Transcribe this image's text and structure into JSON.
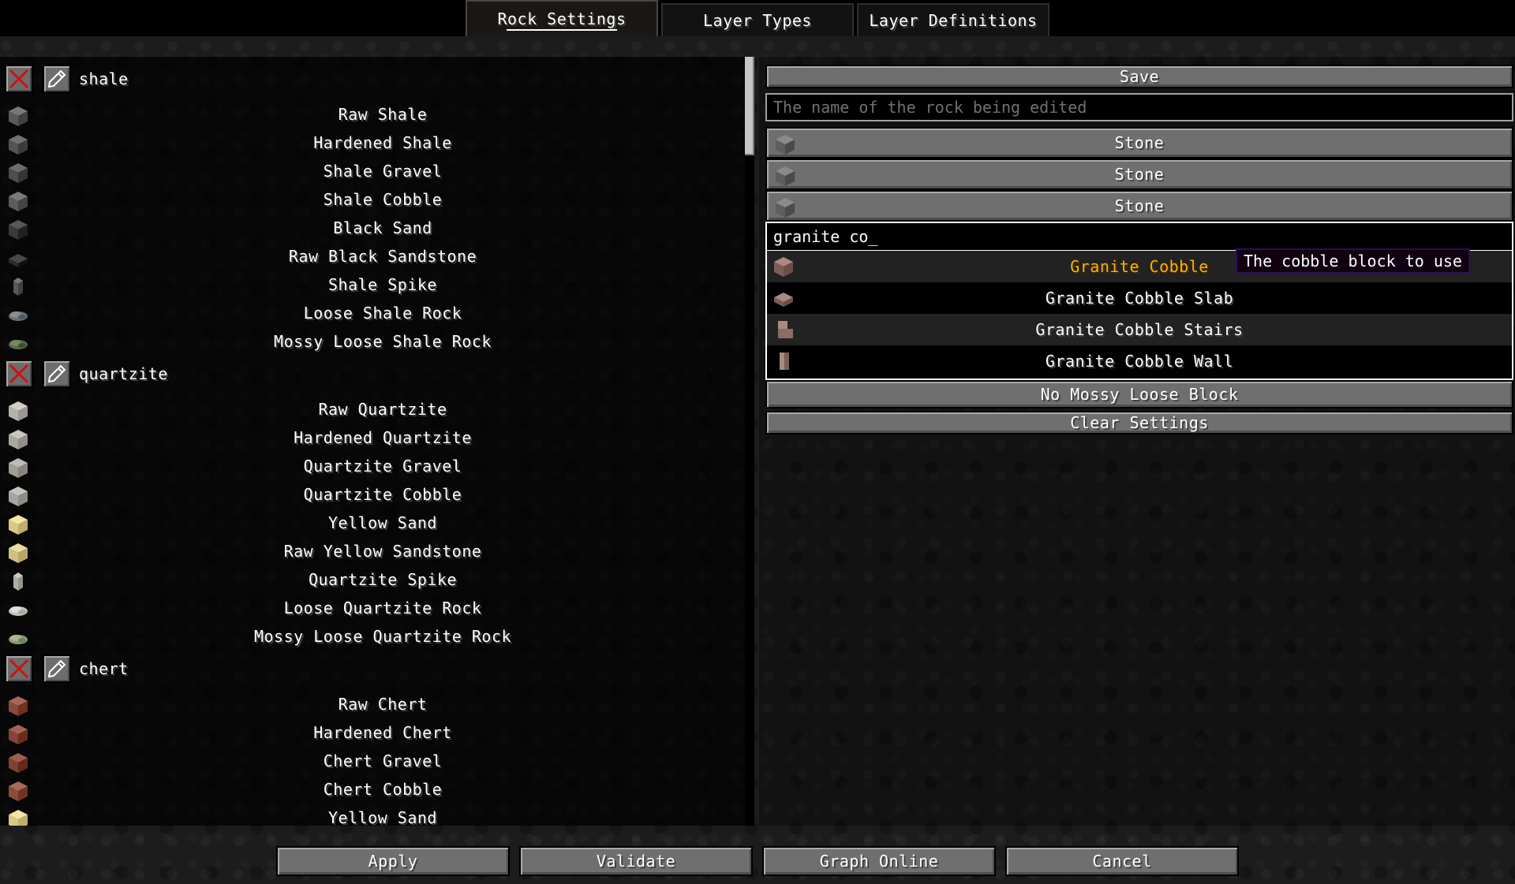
{
  "tabs": [
    {
      "label": "Rock Settings",
      "active": true
    },
    {
      "label": "Layer Types",
      "active": false
    },
    {
      "label": "Layer Definitions",
      "active": false
    }
  ],
  "rocks": [
    {
      "name": "shale",
      "blocks": [
        {
          "label": "Raw Shale",
          "icon": "cube-icon",
          "color": "#5a5a5a"
        },
        {
          "label": "Hardened Shale",
          "icon": "cube-icon",
          "color": "#545454"
        },
        {
          "label": "Shale Gravel",
          "icon": "cube-icon",
          "color": "#4e4e4e"
        },
        {
          "label": "Shale Cobble",
          "icon": "cube-icon",
          "color": "#5c5c5c"
        },
        {
          "label": "Black Sand",
          "icon": "cube-icon",
          "color": "#3a3a3a"
        },
        {
          "label": "Raw Black Sandstone",
          "icon": "slab-icon",
          "color": "#2a2a2a"
        },
        {
          "label": "Shale Spike",
          "icon": "spike-icon",
          "color": "#5a5a5a"
        },
        {
          "label": "Loose Shale Rock",
          "icon": "rock-icon",
          "color": "#6a7076"
        },
        {
          "label": "Mossy Loose Shale Rock",
          "icon": "rock-icon",
          "color": "#5a6a48"
        }
      ]
    },
    {
      "name": "quartzite",
      "blocks": [
        {
          "label": "Raw Quartzite",
          "icon": "cube-icon",
          "color": "#b4b0aa"
        },
        {
          "label": "Hardened Quartzite",
          "icon": "cube-icon",
          "color": "#aaa6a0"
        },
        {
          "label": "Quartzite Gravel",
          "icon": "cube-icon",
          "color": "#a09c96"
        },
        {
          "label": "Quartzite Cobble",
          "icon": "cube-icon",
          "color": "#a8a4a0"
        },
        {
          "label": "Yellow Sand",
          "icon": "cube-icon",
          "color": "#d8c888"
        },
        {
          "label": "Raw Yellow Sandstone",
          "icon": "cube-icon",
          "color": "#cfc080"
        },
        {
          "label": "Quartzite Spike",
          "icon": "spike-icon",
          "color": "#b0aca8"
        },
        {
          "label": "Loose Quartzite Rock",
          "icon": "rock-icon",
          "color": "#c4c0bc"
        },
        {
          "label": "Mossy Loose Quartzite Rock",
          "icon": "rock-icon",
          "color": "#8a9a78"
        }
      ]
    },
    {
      "name": "chert",
      "blocks": [
        {
          "label": "Raw Chert",
          "icon": "cube-icon",
          "color": "#8a4a3a"
        },
        {
          "label": "Hardened Chert",
          "icon": "cube-icon",
          "color": "#844538"
        },
        {
          "label": "Chert Gravel",
          "icon": "cube-icon",
          "color": "#7e4234"
        },
        {
          "label": "Chert Cobble",
          "icon": "cube-icon",
          "color": "#8c4c3c"
        },
        {
          "label": "Yellow Sand",
          "icon": "cube-icon",
          "color": "#d8c888"
        }
      ]
    }
  ],
  "editor": {
    "save_label": "Save",
    "name_placeholder": "The name of the rock being edited",
    "stone_buttons": [
      "Stone",
      "Stone",
      "Stone"
    ],
    "search_value": "granite co_",
    "results": [
      {
        "label": "Granite Cobble",
        "color": "#8a6a62",
        "hover": true
      },
      {
        "label": "Granite Cobble Slab",
        "color": "#8a6a62",
        "hover": false
      },
      {
        "label": "Granite Cobble Stairs",
        "color": "#8a6a62",
        "hover": false
      },
      {
        "label": "Granite Cobble Wall",
        "color": "#8a6a62",
        "hover": false
      }
    ],
    "tooltip": "The cobble block to use",
    "mossy_label": "No Mossy Loose Block",
    "clear_label": "Clear Settings"
  },
  "footer": {
    "apply": "Apply",
    "validate": "Validate",
    "graph_online": "Graph Online",
    "cancel": "Cancel"
  },
  "colors": {
    "hover_text": "#ffb000",
    "delete_red": "#d01010",
    "stone_icon": "#6a6a6a"
  }
}
